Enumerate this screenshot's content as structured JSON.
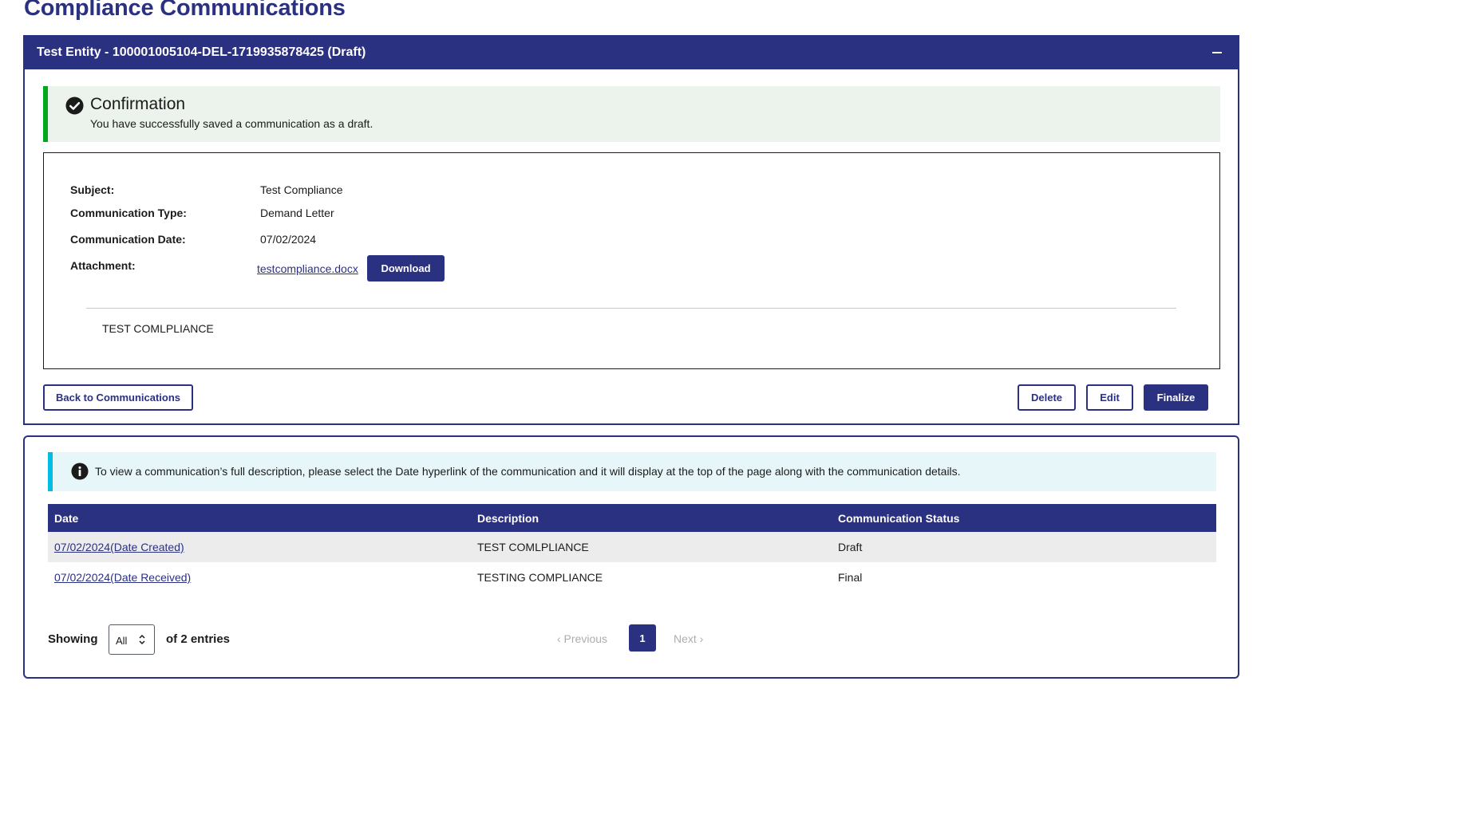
{
  "page": {
    "title": "Compliance Communications"
  },
  "record_panel": {
    "header_title": "Test Entity - 100001005104-DEL-1719935878425 (Draft)",
    "collapse_icon": "minus-icon",
    "confirmation": {
      "icon": "check-circle-icon",
      "title": "Confirmation",
      "message": "You have successfully saved a communication as a draft.",
      "accent_color": "#00a91c"
    },
    "details": {
      "subject_label": "Subject:",
      "subject_value": "Test Compliance",
      "type_label": "Communication Type:",
      "type_value": "Demand Letter",
      "date_label": "Communication Date:",
      "date_value": "07/02/2024",
      "attachment_label": "Attachment:",
      "attachment_file": "testcompliance.docx",
      "download_label": "Download",
      "description": "TEST COMLPLIANCE"
    },
    "actions": {
      "back_label": "Back to Communications",
      "delete_label": "Delete",
      "edit_label": "Edit",
      "finalize_label": "Finalize"
    }
  },
  "history_panel": {
    "info": {
      "icon": "info-icon",
      "text": "To view a communication’s full description, please select the Date hyperlink of the communication and it will display at the top of the page along with the communication details.",
      "accent_color": "#00bde3"
    },
    "table": {
      "columns": [
        "Date",
        "Description",
        "Communication Status"
      ],
      "rows": [
        [
          "07/02/2024(Date Created)",
          "TEST COMLPLIANCE",
          "Draft"
        ],
        [
          "07/02/2024(Date Received)",
          "TESTING COMPLIANCE",
          "Final"
        ]
      ]
    },
    "footer": {
      "showing_label": "Showing",
      "page_size": "All",
      "entries_label": "of 2 entries",
      "previous_label": "‹ Previous",
      "current_page": "1",
      "next_label": "Next ›"
    }
  },
  "colors": {
    "primary": "#2b3181"
  }
}
